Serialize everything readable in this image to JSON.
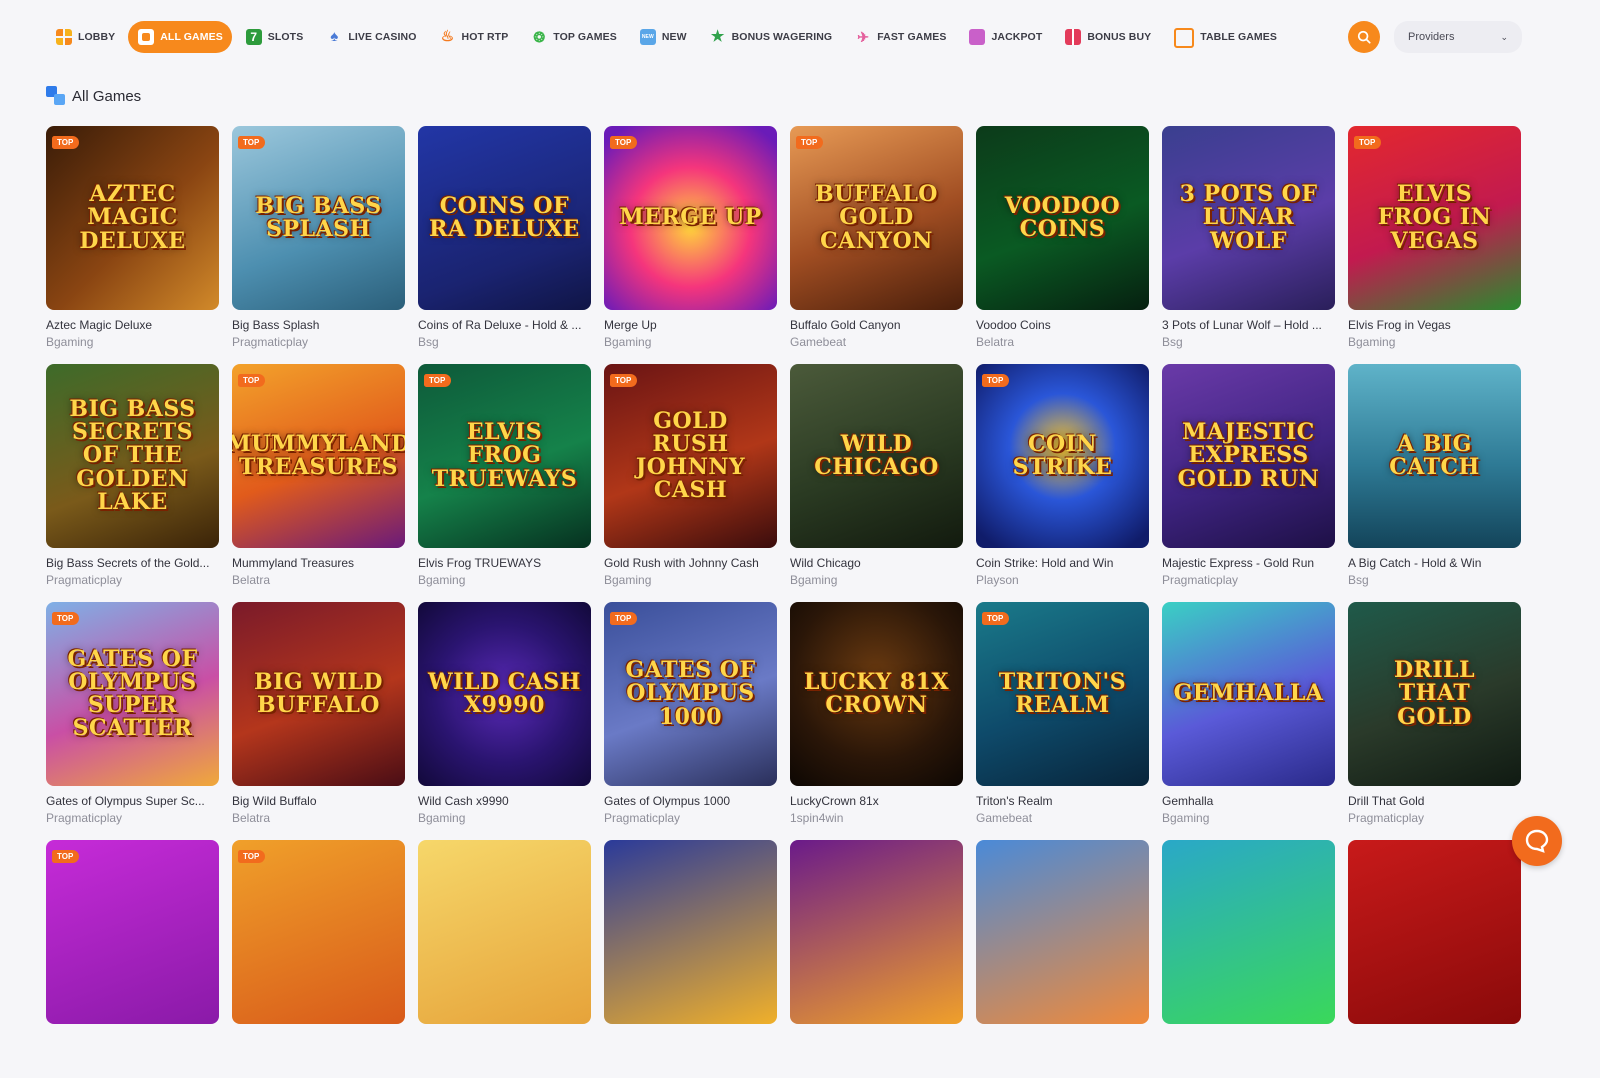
{
  "nav": {
    "tabs": [
      {
        "label": "Lobby",
        "icon": "grid-icon",
        "active": false
      },
      {
        "label": "All Games",
        "icon": "dice-icon",
        "active": true
      },
      {
        "label": "Slots",
        "icon": "seven-icon",
        "active": false
      },
      {
        "label": "Live Casino",
        "icon": "spade-icon",
        "active": false
      },
      {
        "label": "Hot RTP",
        "icon": "flame-icon",
        "active": false
      },
      {
        "label": "Top Games",
        "icon": "trophy-icon",
        "active": false
      },
      {
        "label": "New",
        "icon": "new-icon",
        "active": false
      },
      {
        "label": "Bonus Wagering",
        "icon": "star-icon",
        "active": false
      },
      {
        "label": "Fast Games",
        "icon": "fast-icon",
        "active": false
      },
      {
        "label": "Jackpot",
        "icon": "pot-icon",
        "active": false
      },
      {
        "label": "Bonus Buy",
        "icon": "gift-icon",
        "active": false
      },
      {
        "label": "Table Games",
        "icon": "table-icon",
        "active": false
      }
    ],
    "providers_label": "Providers"
  },
  "section": {
    "title": "All Games"
  },
  "badge_label": "TOP",
  "colors": {
    "accent": "#f7891c",
    "badge": "#f26b1d"
  },
  "games": [
    {
      "name": "Aztec Magic Deluxe",
      "provider": "Bgaming",
      "art": "Aztec Magic Deluxe",
      "top": true,
      "bg": "linear-gradient(135deg,#3a1c08,#8a4512 55%,#d28a2a)"
    },
    {
      "name": "Big Bass Splash",
      "provider": "Pragmaticplay",
      "art": "Big Bass Splash",
      "top": true,
      "bg": "linear-gradient(160deg,#9bc7dc,#4d8fb0 60%,#2b5f7a)"
    },
    {
      "name": "Coins of Ra Deluxe - Hold & ...",
      "provider": "Bsg",
      "art": "Coins of Ra Deluxe",
      "top": false,
      "bg": "linear-gradient(160deg,#2236a6,#1a2370 70%,#101546)"
    },
    {
      "name": "Merge Up",
      "provider": "Bgaming",
      "art": "Merge Up",
      "top": true,
      "bg": "radial-gradient(circle at 50% 55%,#ffd43b,#f5357c 45%,#6a1bb8 90%)"
    },
    {
      "name": "Buffalo Gold Canyon",
      "provider": "Gamebeat",
      "art": "Buffalo Gold Canyon",
      "top": true,
      "bg": "linear-gradient(160deg,#e79a55,#a04d22 55%,#4a1f0b)"
    },
    {
      "name": "Voodoo Coins",
      "provider": "Belatra",
      "art": "Voodoo Coins",
      "top": false,
      "bg": "linear-gradient(160deg,#0c3b1a,#0a5a23 55%,#062010)"
    },
    {
      "name": "3 Pots of Lunar Wolf – Hold ...",
      "provider": "Bsg",
      "art": "3 Pots of Lunar Wolf",
      "top": false,
      "bg": "linear-gradient(160deg,#3a3f8f,#5b3da8 55%,#2a1f5a)"
    },
    {
      "name": "Elvis Frog in Vegas",
      "provider": "Bgaming",
      "art": "Elvis Frog in Vegas",
      "top": true,
      "bg": "linear-gradient(160deg,#e3282e,#c21a4f 55%,#2a8a2f)"
    },
    {
      "name": "Big Bass Secrets of the Gold...",
      "provider": "Pragmaticplay",
      "art": "Big Bass Secrets of The Golden Lake",
      "top": false,
      "bg": "linear-gradient(160deg,#3d6b2a,#7a5a1a 60%,#3a2308)"
    },
    {
      "name": "Mummyland Treasures",
      "provider": "Belatra",
      "art": "Mummyland Treasures",
      "top": true,
      "bg": "linear-gradient(160deg,#f3a22b,#e15b1b 55%,#6a1a7a)"
    },
    {
      "name": "Elvis Frog TRUEWAYS",
      "provider": "Bgaming",
      "art": "Elvis Frog Trueways",
      "top": true,
      "bg": "linear-gradient(160deg,#0e5a3a,#15824a 55%,#063120)"
    },
    {
      "name": "Gold Rush with Johnny Cash",
      "provider": "Bgaming",
      "art": "Gold Rush Johnny Cash",
      "top": true,
      "bg": "linear-gradient(160deg,#6a1414,#b13718 55%,#3a0c0c)"
    },
    {
      "name": "Wild Chicago",
      "provider": "Bgaming",
      "art": "Wild Chicago",
      "top": false,
      "bg": "linear-gradient(160deg,#4b5a3a,#2a3a22 55%,#121a0e)"
    },
    {
      "name": "Coin Strike: Hold and Win",
      "provider": "Playson",
      "art": "Coin Strike",
      "top": true,
      "bg": "radial-gradient(circle at 50% 45%,#f6c32a,#2a56d8 40%,#101c6a 90%)"
    },
    {
      "name": "Majestic Express - Gold Run",
      "provider": "Pragmaticplay",
      "art": "Majestic Express Gold Run",
      "top": false,
      "bg": "linear-gradient(160deg,#6a3aa8,#3f2482 55%,#1e1046)"
    },
    {
      "name": "A Big Catch - Hold & Win",
      "provider": "Bsg",
      "art": "A Big Catch",
      "top": false,
      "bg": "linear-gradient(180deg,#5fb3c9,#2e7a95 55%,#13445a)"
    },
    {
      "name": "Gates of Olympus Super Sc...",
      "provider": "Pragmaticplay",
      "art": "Gates of Olympus Super Scatter",
      "top": true,
      "bg": "linear-gradient(160deg,#7fb0e6,#c94fa5 55%,#f0a93a)"
    },
    {
      "name": "Big Wild Buffalo",
      "provider": "Belatra",
      "art": "Big Wild Buffalo",
      "top": false,
      "bg": "linear-gradient(160deg,#7a1a2a,#b4361c 55%,#4a0d15)"
    },
    {
      "name": "Wild Cash x9990",
      "provider": "Bgaming",
      "art": "Wild Cash x9990",
      "top": false,
      "bg": "radial-gradient(circle at 50% 50%,#5a2ab8,#2a1470 55%,#12093a)"
    },
    {
      "name": "Gates of Olympus 1000",
      "provider": "Pragmaticplay",
      "art": "Gates of Olympus 1000",
      "top": true,
      "bg": "linear-gradient(160deg,#3a4f9a,#6a7ac6 55%,#2a2f5a)"
    },
    {
      "name": "LuckyCrown 81x",
      "provider": "1spin4win",
      "art": "Lucky 81x Crown",
      "top": false,
      "bg": "radial-gradient(circle at 50% 40%,#6a3a10,#2a1608 60%,#0d0703)"
    },
    {
      "name": "Triton's Realm",
      "provider": "Gamebeat",
      "art": "Triton's Realm",
      "top": true,
      "bg": "linear-gradient(160deg,#1a7a8a,#0e4a6a 55%,#08243a)"
    },
    {
      "name": "Gemhalla",
      "provider": "Bgaming",
      "art": "Gemhalla",
      "top": false,
      "bg": "linear-gradient(160deg,#3ad0c4,#5a5ad8 55%,#2a2a8a)"
    },
    {
      "name": "Drill That Gold",
      "provider": "Pragmaticplay",
      "art": "Drill That Gold",
      "top": false,
      "bg": "linear-gradient(160deg,#1f5a4a,#2a3a2a 55%,#101a12)"
    },
    {
      "name": "",
      "provider": "",
      "art": "",
      "top": true,
      "bg": "linear-gradient(160deg,#c62bd8,#8a1aa8)"
    },
    {
      "name": "",
      "provider": "",
      "art": "",
      "top": true,
      "bg": "linear-gradient(160deg,#f0a02a,#d85a1a)"
    },
    {
      "name": "",
      "provider": "",
      "art": "",
      "top": false,
      "bg": "linear-gradient(160deg,#f6d76a,#e6a33a)"
    },
    {
      "name": "",
      "provider": "",
      "art": "",
      "top": false,
      "bg": "linear-gradient(160deg,#2a3a9a,#f0b02a)"
    },
    {
      "name": "",
      "provider": "",
      "art": "",
      "top": false,
      "bg": "linear-gradient(160deg,#6a1a8a,#f0a02a)"
    },
    {
      "name": "",
      "provider": "",
      "art": "",
      "top": false,
      "bg": "linear-gradient(160deg,#4a8ad8,#f08a3a)"
    },
    {
      "name": "",
      "provider": "",
      "art": "",
      "top": false,
      "bg": "linear-gradient(160deg,#2aa8c8,#3ad85a)"
    },
    {
      "name": "",
      "provider": "",
      "art": "",
      "top": false,
      "bg": "linear-gradient(160deg,#c81a1a,#8a0a0a)"
    }
  ]
}
